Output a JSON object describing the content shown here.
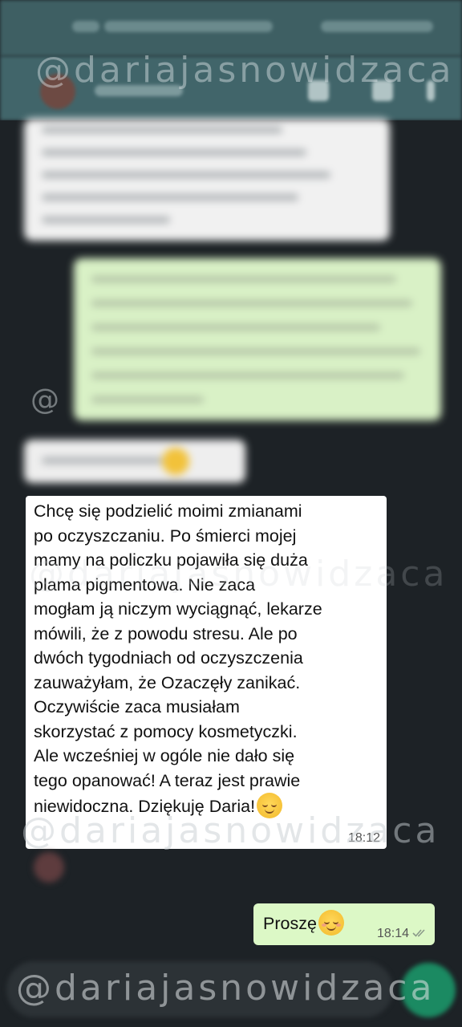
{
  "watermark": {
    "text": "@dariajasnowidzaca",
    "partial": "@"
  },
  "messages": {
    "incoming": {
      "text": "Chcę się podzielić moimi zmianami\npo oczyszczaniu. Po śmierci mojej\nmamy na policzku pojawiła się duża\nplama pigmentowa. Nie zaca\nmogłam ją niczym wyciągnąć, lekarze\nmówili, że z powodu stresu. Ale po\ndwóch tygodniach od oczyszczenia\nzauważyłam, że Ozaczęły zanikać.\nOczywiście zaca musiałam\nskorzystać z pomocy kosmetyczki.\nAle wcześniej w ogóle nie dało się\ntego opanować! A teraz jest prawie\nniewidoczna. Dziękuję Daria!",
      "emoji": "relieved-face-emoji",
      "time": "18:12"
    },
    "outgoing": {
      "text": "Proszę",
      "emoji": "smiling-face-emoji",
      "time": "18:14",
      "status": "read-double-check"
    }
  },
  "colors": {
    "header": "#41656a",
    "incoming_bubble": "#ffffff",
    "outgoing_bubble": "#dcf8c6",
    "background": "#1d2226",
    "send_button": "#1b8a62"
  }
}
